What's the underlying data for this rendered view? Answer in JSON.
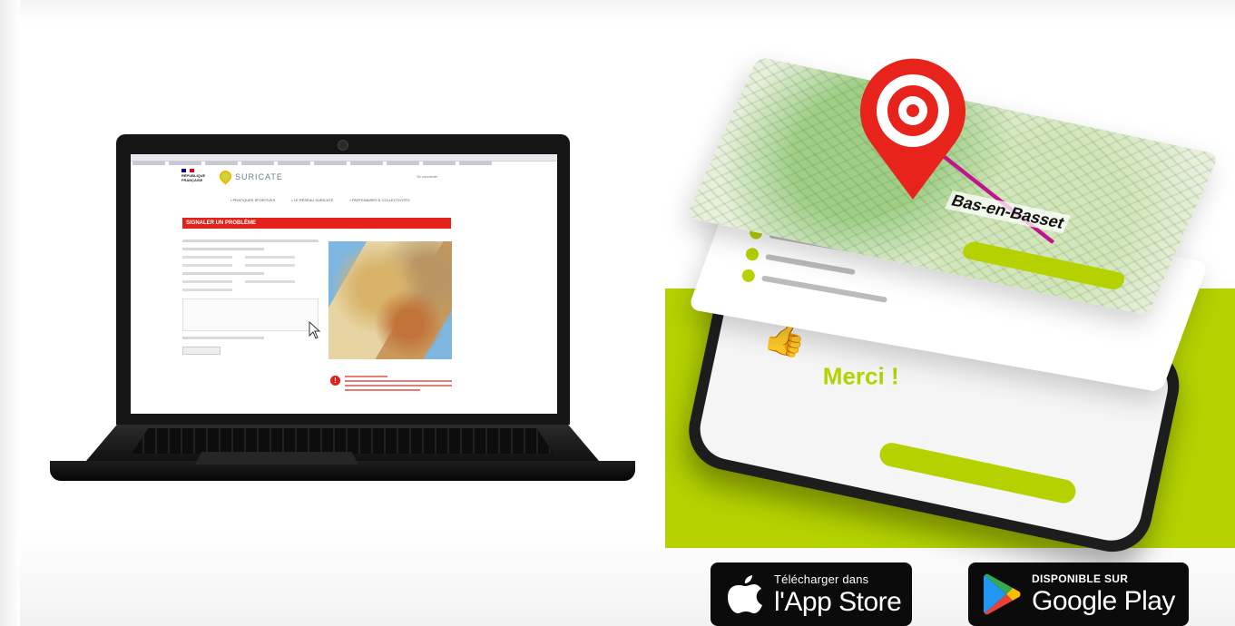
{
  "laptop": {
    "site": {
      "republic_label": "RÉPUBLIQUE FRANÇAISE",
      "brand_name": "SURICATE",
      "header_link": "Se connecter",
      "nav": [
        "PRATIQUES SPORTIVES",
        "LE RÉSEAU SURICATE",
        "PARTENAIRES & COLLECTIVITÉS"
      ],
      "banner": "SIGNALER UN PROBLÈME"
    }
  },
  "phone": {
    "thanks_text": "Merci !",
    "place_name": "Bas-en-Basset"
  },
  "stores": {
    "apple": {
      "small": "Télécharger dans",
      "big": "l'App Store"
    },
    "google": {
      "small": "DISPONIBLE SUR",
      "big": "Google Play"
    }
  },
  "colors": {
    "accent_green": "#b5d200",
    "alert_red": "#e32119",
    "pin_red": "#e8231b"
  }
}
